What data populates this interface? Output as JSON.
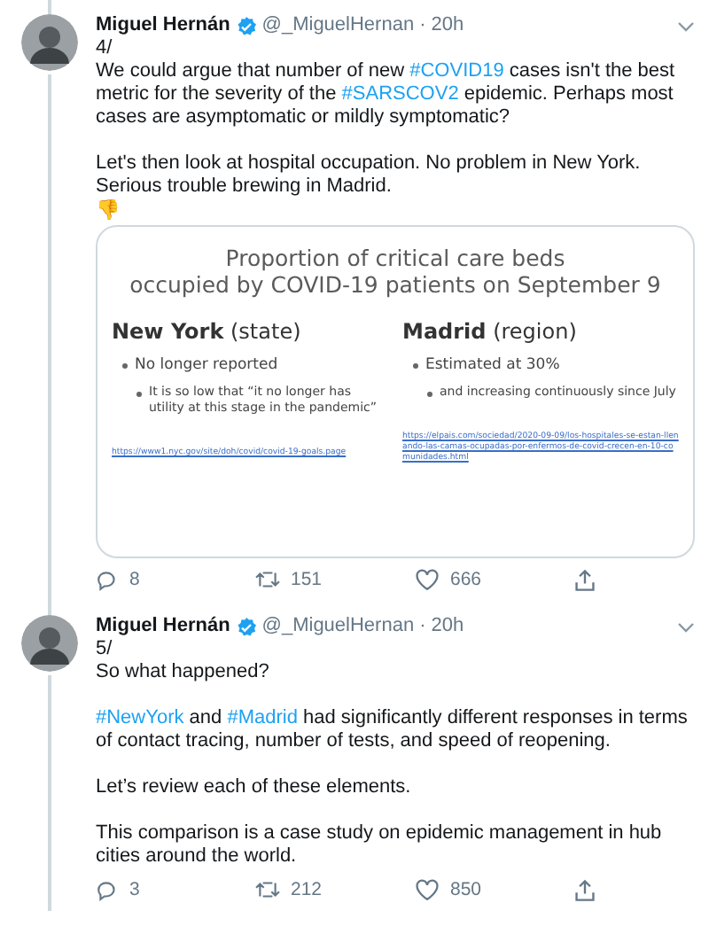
{
  "tweets": [
    {
      "author": "Miguel Hernán",
      "verified": true,
      "handle": "@_MiguelHernan",
      "separator": "·",
      "time": "20h",
      "number": "4/",
      "paragraphs": [
        [
          {
            "kind": "text",
            "text": "We could argue that number of new "
          },
          {
            "kind": "hashtag",
            "text": "#COVID19"
          },
          {
            "kind": "text",
            "text": " cases isn't the best metric for the severity of the "
          },
          {
            "kind": "hashtag",
            "text": "#SARSCOV2"
          },
          {
            "kind": "text",
            "text": " epidemic. Perhaps most cases are asymptomatic or mildly symptomatic?"
          }
        ],
        [
          {
            "kind": "text",
            "text": "Let's then look at hospital occupation. No problem in New York. Serious trouble brewing in Madrid."
          }
        ]
      ],
      "emoji": "👎",
      "slide": {
        "title": [
          "Proportion of critical care beds",
          "occupied by COVID-19 patients on September 9"
        ],
        "columns": [
          {
            "heading": "New York",
            "qualifier": "(state)",
            "items": [
              {
                "text": "No longer reported",
                "children": [
                  {
                    "text": "It is so low that “it no longer has utility at this stage in the pandemic”"
                  }
                ]
              }
            ],
            "source": "https://www1.nyc.gov/site/doh/covid/covid-19-goals.page"
          },
          {
            "heading": "Madrid",
            "qualifier": "(region)",
            "items": [
              {
                "text": "Estimated at 30%",
                "children": [
                  {
                    "text": "and increasing continuously since July"
                  }
                ]
              }
            ],
            "source": "https://elpais.com/sociedad/2020-09-09/los-hospitales-se-estan-llenando-las-camas-ocupadas-por-enfermos-de-covid-crecen-en-10-comunidades.html"
          }
        ]
      },
      "actions": {
        "replies": "8",
        "retweets": "151",
        "likes": "666"
      }
    },
    {
      "author": "Miguel Hernán",
      "verified": true,
      "handle": "@_MiguelHernan",
      "separator": "·",
      "time": "20h",
      "number": "5/",
      "paragraphs": [
        [
          {
            "kind": "text",
            "text": "So what happened?"
          }
        ],
        [
          {
            "kind": "hashtag",
            "text": "#NewYork"
          },
          {
            "kind": "text",
            "text": " and "
          },
          {
            "kind": "hashtag",
            "text": "#Madrid"
          },
          {
            "kind": "text",
            "text": " had significantly different responses in terms of contact tracing, number of tests, and speed of reopening."
          }
        ],
        [
          {
            "kind": "text",
            "text": "Let’s review each of these elements."
          }
        ],
        [
          {
            "kind": "text",
            "text": "This comparison is a case study on epidemic management in hub cities around the world."
          }
        ]
      ],
      "actions": {
        "replies": "3",
        "retweets": "212",
        "likes": "850"
      }
    }
  ]
}
